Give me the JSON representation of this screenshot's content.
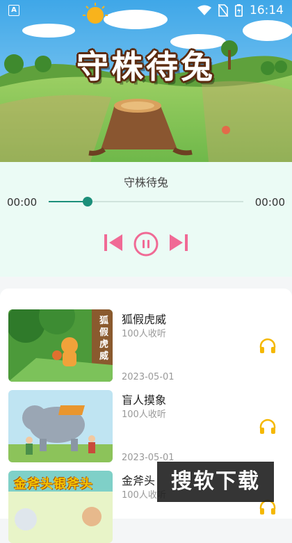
{
  "status": {
    "time": "16:14",
    "app_badge": "A"
  },
  "cover": {
    "title": "守株待兔"
  },
  "player": {
    "track_title": "守株待兔",
    "elapsed": "00:00",
    "duration": "00:00",
    "progress": 0.2
  },
  "list": {
    "items": [
      {
        "name": "狐假虎威",
        "plays": "100人收听",
        "date": "2023-05-01",
        "thumb_text": "狐假虎威"
      },
      {
        "name": "盲人摸象",
        "plays": "100人收听",
        "date": "2023-05-01",
        "thumb_text": ""
      },
      {
        "name": "金斧头",
        "plays": "100人收听",
        "date": "",
        "thumb_text": "金斧头银斧头"
      }
    ]
  },
  "watermark": {
    "text": "搜软下载"
  },
  "colors": {
    "accent": "#1c8f7a",
    "control_pink": "#f06a95",
    "headphone": "#f5b800",
    "player_bg": "#ebfbf5"
  }
}
